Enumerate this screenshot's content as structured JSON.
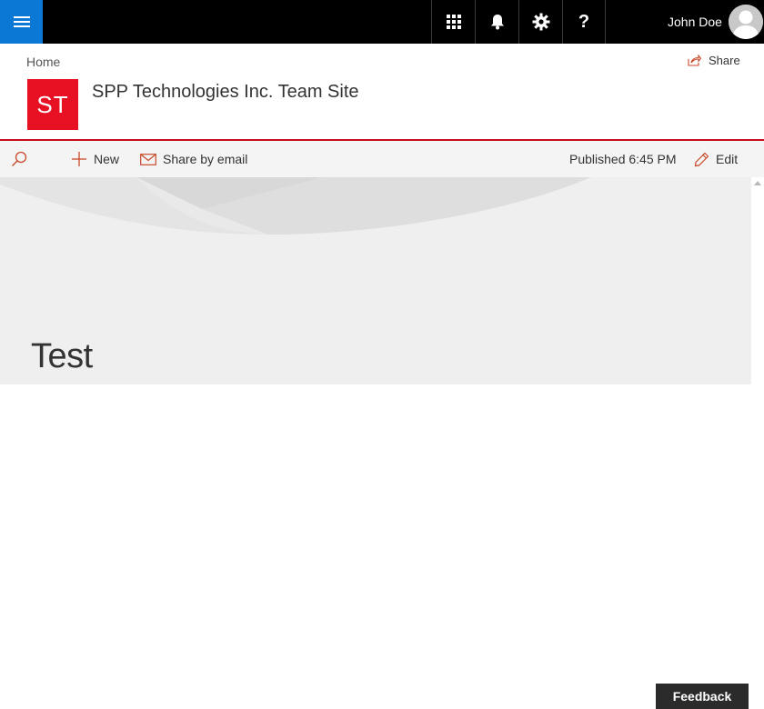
{
  "suitebar": {
    "menu_icon": "hamburger-icon",
    "buttons": [
      {
        "icon": "app-launcher-icon"
      },
      {
        "icon": "bell-icon"
      },
      {
        "icon": "gear-icon"
      },
      {
        "icon": "help-icon",
        "label": "?"
      }
    ],
    "user_name": "John Doe",
    "avatar_icon": "person-icon"
  },
  "site": {
    "breadcrumb": "Home",
    "share_label": "Share",
    "logo_text": "ST",
    "title": "SPP Technologies Inc. Team Site"
  },
  "commandbar": {
    "search_icon": "search-icon",
    "new_label": "New",
    "share_email_label": "Share by email",
    "published_label": "Published 6:45 PM",
    "edit_label": "Edit"
  },
  "page": {
    "title": "Test"
  },
  "feedback_label": "Feedback",
  "colors": {
    "accent": "#0a78d4",
    "brand_red": "#e81123",
    "command_red": "#c50f1f",
    "suitebar": "#000000",
    "hero_bg": "#efefef"
  }
}
